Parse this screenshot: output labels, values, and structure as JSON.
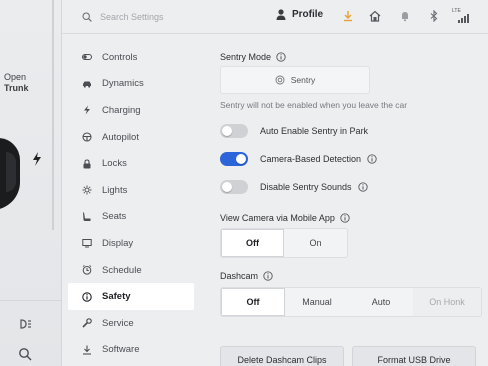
{
  "car_panel": {
    "trunk_line1": "Open",
    "trunk_line2": "Trunk"
  },
  "topbar": {
    "search_placeholder": "Search Settings",
    "profile_label": "Profile",
    "icons": [
      "download-icon",
      "home-icon",
      "bell-icon",
      "bluetooth-icon",
      "lte-signal-icon"
    ],
    "lte_label": "LTE"
  },
  "menu": {
    "items": [
      {
        "label": "Controls",
        "icon": "toggle-icon"
      },
      {
        "label": "Dynamics",
        "icon": "car-icon"
      },
      {
        "label": "Charging",
        "icon": "bolt-icon"
      },
      {
        "label": "Autopilot",
        "icon": "steering-wheel-icon"
      },
      {
        "label": "Locks",
        "icon": "lock-icon"
      },
      {
        "label": "Lights",
        "icon": "sun-icon"
      },
      {
        "label": "Seats",
        "icon": "seat-icon"
      },
      {
        "label": "Display",
        "icon": "display-icon"
      },
      {
        "label": "Schedule",
        "icon": "clock-icon"
      },
      {
        "label": "Safety",
        "icon": "info-circle-icon"
      },
      {
        "label": "Service",
        "icon": "wrench-icon"
      },
      {
        "label": "Software",
        "icon": "download-icon"
      }
    ],
    "active": "Safety"
  },
  "sentry": {
    "title": "Sentry Mode",
    "button_label": "Sentry",
    "note": "Sentry will not be enabled when you leave the car"
  },
  "toggles": [
    {
      "label": "Auto Enable Sentry in Park",
      "on": false
    },
    {
      "label": "Camera-Based Detection",
      "on": true
    },
    {
      "label": "Disable Sentry Sounds",
      "on": false
    }
  ],
  "view_camera": {
    "title": "View Camera via Mobile App",
    "options": [
      "Off",
      "On"
    ],
    "selected": "Off"
  },
  "dashcam": {
    "title": "Dashcam",
    "options": [
      "Off",
      "Manual",
      "Auto",
      "On Honk"
    ],
    "selected": "Off",
    "disabled": [
      "On Honk"
    ]
  },
  "buttons": {
    "delete_clips": "Delete Dashcam Clips",
    "format_usb": "Format USB Drive"
  },
  "colors": {
    "toggle_on": "#2c64d9",
    "accent_download": "#e8a23a"
  }
}
